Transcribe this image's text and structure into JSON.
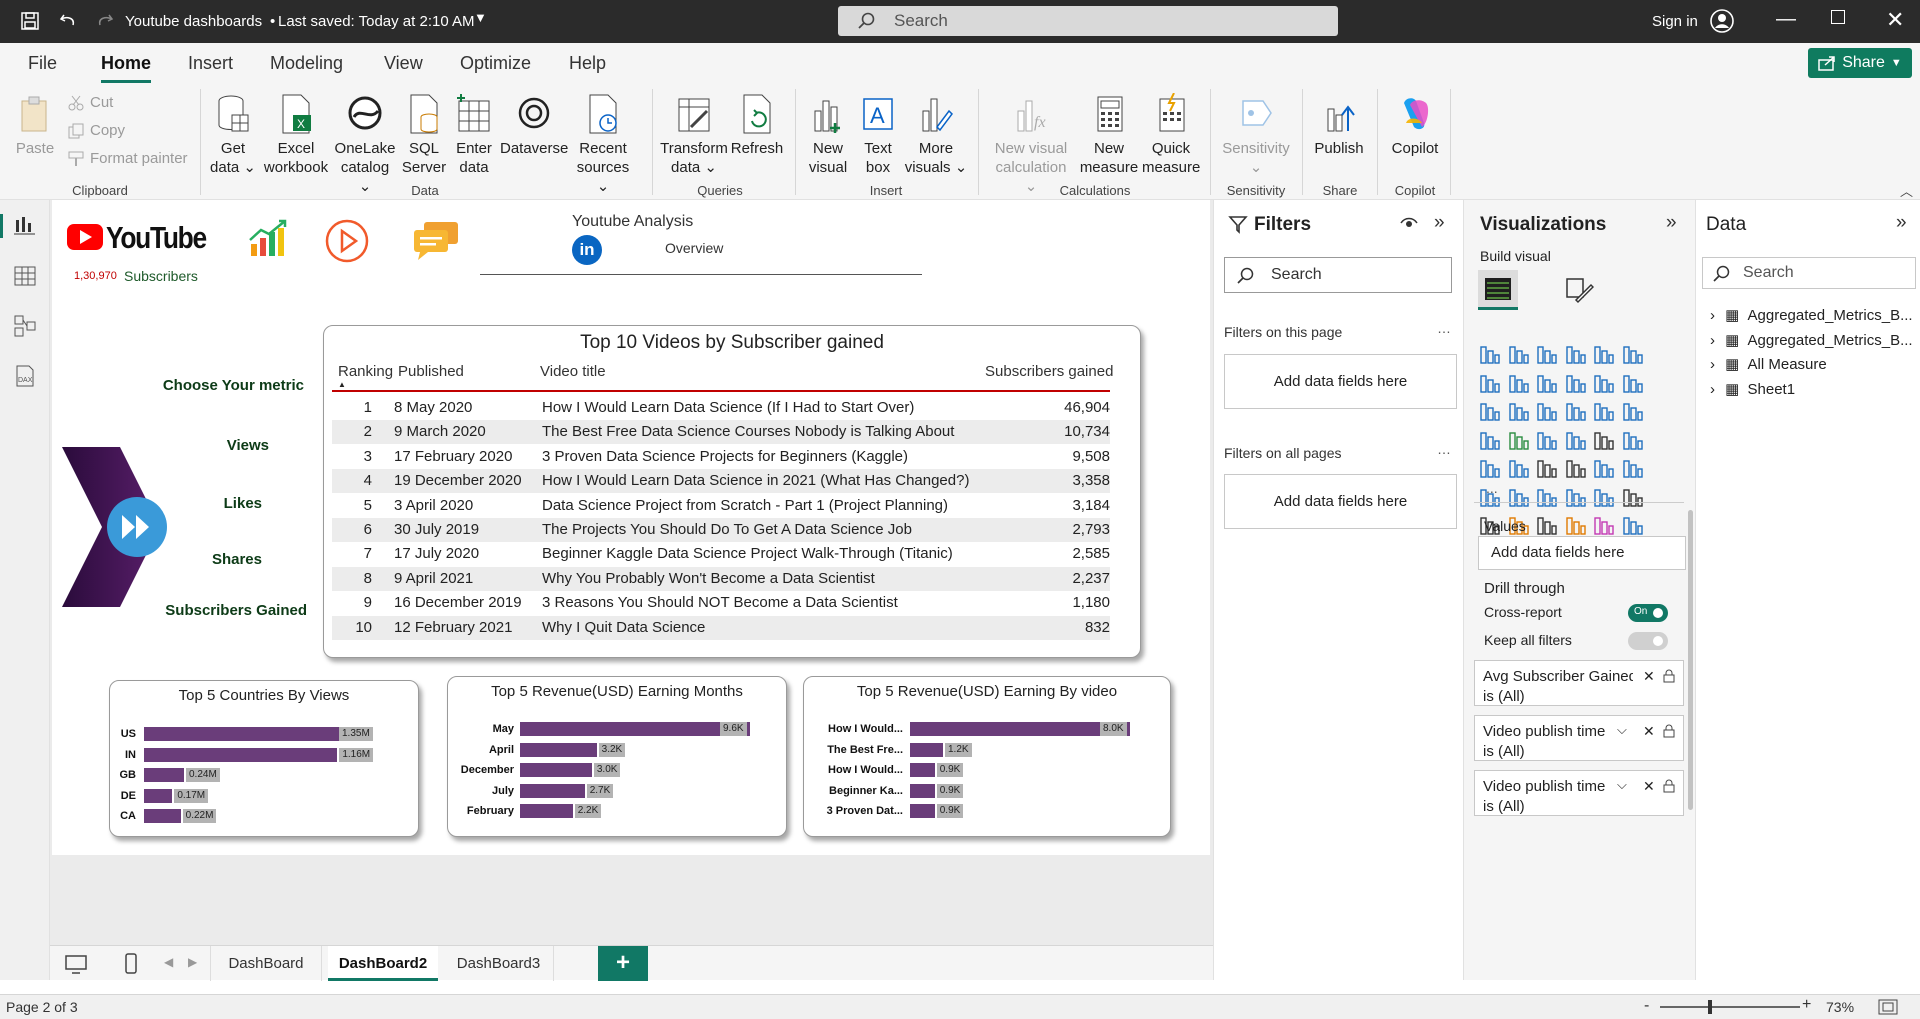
{
  "titlebar": {
    "doc_title": "Youtube dashboards",
    "saved": "Last saved: Today at 2:10 AM",
    "search_placeholder": "Search",
    "sign_in": "Sign in"
  },
  "menu": {
    "tabs": [
      "File",
      "Home",
      "Insert",
      "Modeling",
      "View",
      "Optimize",
      "Help"
    ],
    "active": "Home",
    "share": "Share"
  },
  "ribbon": {
    "clipboard": {
      "paste": "Paste",
      "cut": "Cut",
      "copy": "Copy",
      "format_painter": "Format painter",
      "group": "Clipboard"
    },
    "data": {
      "get_data": [
        "Get",
        "data"
      ],
      "excel": [
        "Excel",
        "workbook"
      ],
      "onelake": [
        "OneLake",
        "catalog"
      ],
      "sql": [
        "SQL",
        "Server"
      ],
      "enter": [
        "Enter",
        "data"
      ],
      "dataverse": [
        "Dataverse",
        ""
      ],
      "recent": [
        "Recent",
        "sources"
      ],
      "group": "Data"
    },
    "queries": {
      "transform": [
        "Transform",
        "data"
      ],
      "refresh": [
        "Refresh",
        ""
      ],
      "group": "Queries"
    },
    "insert": {
      "new_visual": [
        "New",
        "visual"
      ],
      "text_box": [
        "Text",
        "box"
      ],
      "more_visuals": [
        "More",
        "visuals"
      ],
      "group": "Insert"
    },
    "calculations": {
      "new_visual_calc": [
        "New visual",
        "calculation"
      ],
      "new_measure": [
        "New",
        "measure"
      ],
      "quick_measure": [
        "Quick",
        "measure"
      ],
      "group": "Calculations"
    },
    "sensitivity": {
      "label": "Sensitivity",
      "group": "Sensitivity"
    },
    "share": {
      "publish": "Publish",
      "group": "Share"
    },
    "copilot": {
      "label": "Copilot",
      "group": "Copilot"
    }
  },
  "report": {
    "youtube_logo": "YouTube",
    "subscribers_count": "1,30,970",
    "subscribers_label": "Subscribers",
    "header_title": "Youtube Analysis",
    "header_subtitle": "Overview",
    "linkedin": "in",
    "metric_title": "Choose Your metric",
    "metrics": [
      "Views",
      "Likes",
      "Shares",
      "Subscribers Gained"
    ],
    "top10": {
      "title": "Top 10 Videos by Subscriber gained",
      "columns": [
        "Ranking",
        "Published",
        "Video title",
        "Subscribers gained"
      ],
      "rows": [
        [
          "1",
          "8 May 2020",
          "How I Would Learn Data Science (If I Had to Start Over)",
          "46,904"
        ],
        [
          "2",
          "9 March 2020",
          "The Best Free Data Science Courses Nobody is Talking About",
          "10,734"
        ],
        [
          "3",
          "17 February 2020",
          "3 Proven Data Science Projects for Beginners (Kaggle)",
          "9,508"
        ],
        [
          "4",
          "19 December 2020",
          "How I Would Learn Data Science in 2021 (What Has Changed?)",
          "3,358"
        ],
        [
          "5",
          "3 April 2020",
          "Data Science Project from Scratch - Part 1 (Project Planning)",
          "3,184"
        ],
        [
          "6",
          "30 July 2019",
          "The Projects You Should Do To Get A Data Science Job",
          "2,793"
        ],
        [
          "7",
          "17 July 2020",
          "Beginner Kaggle Data Science Project Walk-Through (Titanic)",
          "2,585"
        ],
        [
          "8",
          "9 April 2021",
          "Why You Probably Won't Become a Data Scientist",
          "2,237"
        ],
        [
          "9",
          "16 December 2019",
          "3 Reasons You Should NOT Become a Data Scientist",
          "1,180"
        ],
        [
          "10",
          "12 February 2021",
          "Why I Quit Data Science",
          "832"
        ]
      ]
    }
  },
  "chart_data": [
    {
      "type": "bar",
      "title": "Top 5 Countries By Views",
      "categories": [
        "US",
        "IN",
        "GB",
        "DE",
        "CA"
      ],
      "values": [
        1350000,
        1160000,
        240000,
        170000,
        220000
      ],
      "labels": [
        "1.35M",
        "1.16M",
        "0.24M",
        "0.17M",
        "0.22M"
      ]
    },
    {
      "type": "bar",
      "title": "Top 5 Revenue(USD) Earning Months",
      "categories": [
        "May",
        "April",
        "December",
        "July",
        "February"
      ],
      "values": [
        9.6,
        3.2,
        3.0,
        2.7,
        2.2
      ],
      "labels": [
        "9.6K",
        "3.2K",
        "3.0K",
        "2.7K",
        "2.2K"
      ]
    },
    {
      "type": "bar",
      "title": "Top 5 Revenue(USD) Earning By video",
      "categories": [
        "How I Would...",
        "The Best Fre...",
        "How I Would...",
        "Beginner Ka...",
        "3 Proven Dat..."
      ],
      "values": [
        8.0,
        1.2,
        0.9,
        0.9,
        0.9
      ],
      "labels": [
        "8.0K",
        "1.2K",
        "0.9K",
        "0.9K",
        "0.9K"
      ]
    }
  ],
  "filters": {
    "title": "Filters",
    "search_placeholder": "Search",
    "on_this_page": "Filters on this page",
    "on_all_pages": "Filters on all pages",
    "add_fields": "Add data fields here",
    "ellipsis": "…"
  },
  "viz": {
    "title": "Visualizations",
    "build": "Build visual",
    "values": "Values",
    "add_fields": "Add data fields here",
    "drill": "Drill through",
    "cross_report": "Cross-report",
    "cross_on": "On",
    "keep_filters": "Keep all filters",
    "filter_cards": [
      {
        "name": "Avg Subscriber Gained",
        "state": "is (All)"
      },
      {
        "name": "Video publish time",
        "state": "is (All)"
      },
      {
        "name": "Video publish time",
        "state": "is (All)"
      }
    ],
    "more": "...",
    "icons": [
      "stacked-bar",
      "stacked-column",
      "clustered-bar",
      "clustered-column",
      "100-bar",
      "100-column",
      "line",
      "area",
      "stacked-area",
      "100-area",
      "line-column",
      "line-clustered",
      "ribbon",
      "waterfall",
      "funnel",
      "scatter",
      "pie",
      "donut",
      "treemap",
      "map",
      "filled-map",
      "azure-map",
      "gauge",
      "card",
      "multi-card",
      "kpi",
      "slicer",
      "table",
      "matrix",
      "r-visual",
      "python-visual",
      "key-influencers",
      "decomp-tree",
      "qa",
      "smart-narrative",
      "metrics",
      "paginated",
      "power-apps",
      "power-automate",
      "narrative",
      "powerapps2",
      "more-visuals"
    ]
  },
  "data_pane": {
    "title": "Data",
    "search_placeholder": "Search",
    "tables": [
      "Aggregated_Metrics_B...",
      "Aggregated_Metrics_B...",
      "All Measure",
      "Sheet1"
    ]
  },
  "pages": {
    "tabs": [
      "DashBoard",
      "DashBoard2",
      "DashBoard3"
    ],
    "active": "DashBoard2",
    "add": "+"
  },
  "status": {
    "page": "Page 2 of 3",
    "zoom": "73%",
    "minus": "-",
    "plus": "+"
  }
}
